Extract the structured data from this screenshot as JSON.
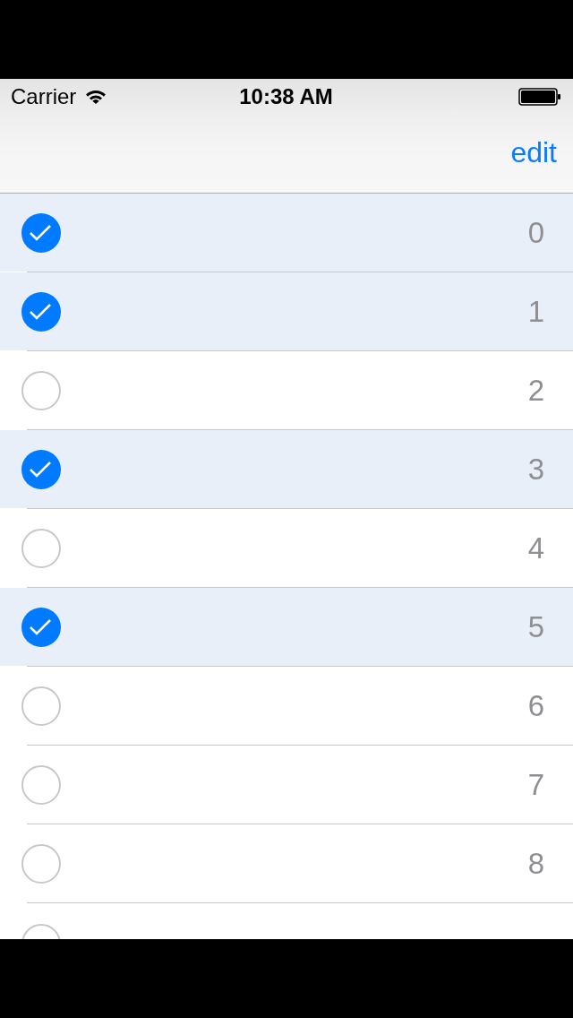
{
  "status_bar": {
    "carrier": "Carrier",
    "time": "10:38 AM"
  },
  "nav_bar": {
    "edit_button": "edit"
  },
  "rows": [
    {
      "kind": "full",
      "label": "0",
      "selected": true
    },
    {
      "kind": "full",
      "label": "1",
      "selected": true
    },
    {
      "kind": "full",
      "label": "2",
      "selected": false
    },
    {
      "kind": "full",
      "label": "3",
      "selected": true
    },
    {
      "kind": "full",
      "label": "4",
      "selected": false
    },
    {
      "kind": "full",
      "label": "5",
      "selected": true
    },
    {
      "kind": "full",
      "label": "6",
      "selected": false
    },
    {
      "kind": "full",
      "label": "7",
      "selected": false
    },
    {
      "kind": "full",
      "label": "8",
      "selected": false
    },
    {
      "kind": "cut",
      "selected": false
    }
  ]
}
